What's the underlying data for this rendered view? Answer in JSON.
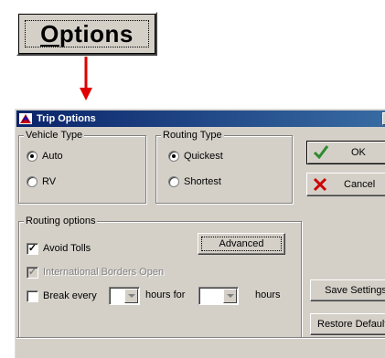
{
  "callout": {
    "options_label": "Options",
    "options_mnemonic": "O",
    "options_rest": "ptions"
  },
  "dialog": {
    "title": "Trip Options",
    "vehicle_type": {
      "legend": "Vehicle Type",
      "options": [
        "Auto",
        "RV"
      ],
      "selected": "Auto"
    },
    "routing_type": {
      "legend": "Routing Type",
      "options": [
        "Quickest",
        "Shortest"
      ],
      "selected": "Quickest"
    },
    "buttons": {
      "ok": "OK",
      "cancel": "Cancel",
      "advanced": "Advanced",
      "save_settings": "Save Settings",
      "restore_defaults": "Restore Defaults"
    },
    "routing_options": {
      "legend": "Routing options",
      "avoid_tolls": {
        "label": "Avoid Tolls",
        "checked": true
      },
      "international_borders": {
        "label": "International Borders Open",
        "checked": true,
        "disabled": true
      },
      "break_every": {
        "label": "Break every",
        "checked": false,
        "hours_for": "hours for",
        "hours": "hours",
        "interval_value": "",
        "duration_value": ""
      }
    }
  },
  "colors": {
    "arrow": "#e00000",
    "title_start": "#0a246a",
    "title_end": "#3a6ea5",
    "dialog_bg": "#d4d0c8",
    "ok_check": "#2e8b2e",
    "cancel_x": "#cc0000"
  },
  "icons": [
    "app-icon",
    "close-icon",
    "check-icon",
    "x-icon",
    "dropdown-arrow-icon",
    "arrow-down-icon"
  ]
}
